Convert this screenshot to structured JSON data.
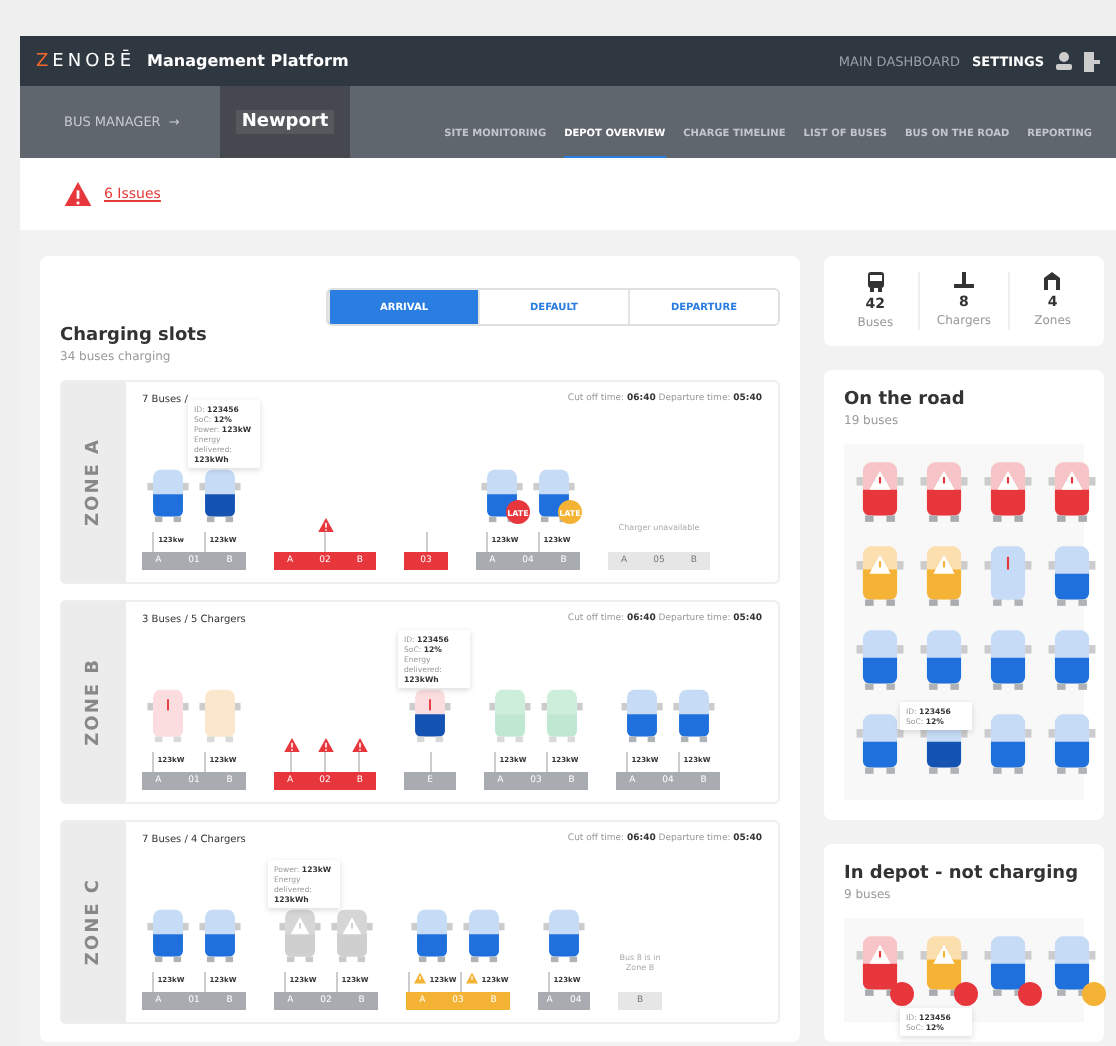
{
  "header": {
    "logo": "ZENOBĒ",
    "title": "Management Platform",
    "links": [
      {
        "label": "MAIN DASHBOARD",
        "selected": false
      },
      {
        "label": "SETTINGS",
        "selected": true
      }
    ]
  },
  "subnav": {
    "section": "BUS MANAGER",
    "arrow": "→",
    "depot": "Newport",
    "tabs": [
      {
        "label": "SITE MONITORING",
        "selected": false
      },
      {
        "label": "DEPOT OVERVIEW",
        "selected": true
      },
      {
        "label": "CHARGE TIMELINE",
        "selected": false
      },
      {
        "label": "LIST OF BUSES",
        "selected": false
      },
      {
        "label": "BUS ON THE ROAD",
        "selected": false
      },
      {
        "label": "REPORTING",
        "selected": false
      }
    ]
  },
  "issues": {
    "label": "6 Issues"
  },
  "charging": {
    "title": "Charging slots",
    "subtitle": "34 buses charging",
    "modes": [
      {
        "label": "ARRIVAL",
        "selected": true
      },
      {
        "label": "DEFAULT",
        "selected": false
      },
      {
        "label": "DEPARTURE",
        "selected": false
      }
    ],
    "zones": [
      {
        "label": "ZONE A",
        "summary": "7 Buses /",
        "cutoff_label": "Cut off time:",
        "cutoff": "06:40",
        "departure_label": "Departure time:",
        "departure": "05:40",
        "groups": [
          {
            "kind": "normal",
            "ports": [
              "A",
              "01",
              "B"
            ],
            "buses": [
              {
                "kind": "normal",
                "selected": false,
                "power": "123kw"
              },
              {
                "kind": "normal",
                "selected": true,
                "power": "123kW",
                "tooltip": [
                  {
                    "label": "ID:",
                    "value": "123456"
                  },
                  {
                    "label": "SoC:",
                    "value": "12%"
                  },
                  {
                    "label": "Power:",
                    "value": "123kW"
                  },
                  {
                    "label": "Energy delivered:",
                    "value": "123kWh"
                  }
                ]
              }
            ]
          },
          {
            "kind": "fault",
            "ports": [
              "A",
              "02",
              "B"
            ],
            "alerts": [
              {
                "kind": "warning"
              }
            ]
          },
          {
            "kind": "fault",
            "ports": [
              "03"
            ]
          },
          {
            "kind": "normal",
            "ports": [
              "A",
              "04",
              "B"
            ],
            "buses": [
              {
                "kind": "normal",
                "selected": false,
                "power": "123kW",
                "badge": {
                  "color": "#e8363d",
                  "text": "LATE"
                }
              },
              {
                "kind": "normal",
                "selected": false,
                "power": "123kW",
                "badge": {
                  "color": "#f5b335",
                  "text": "LATE"
                }
              }
            ]
          },
          {
            "kind": "unavailable",
            "ports": [
              "A",
              "05",
              "B"
            ],
            "note": "Charger unavailable"
          }
        ]
      },
      {
        "label": "ZONE B",
        "summary": "3 Buses / 5 Chargers",
        "cutoff_label": "Cut off time:",
        "cutoff": "06:40",
        "departure_label": "Departure time:",
        "departure": "05:40",
        "groups": [
          {
            "kind": "normal",
            "ports": [
              "A",
              "01",
              "B"
            ],
            "buses": [
              {
                "kind": "fault_faded",
                "selected": false,
                "power": "123kW"
              },
              {
                "kind": "warning_faded",
                "selected": false,
                "power": "123kW"
              }
            ]
          },
          {
            "kind": "fault",
            "ports": [
              "A",
              "02",
              "B"
            ],
            "alerts": [
              {
                "kind": "warning"
              },
              {
                "kind": "warning"
              },
              {
                "kind": "warning"
              }
            ]
          },
          {
            "kind": "normal",
            "ports": [
              "E"
            ],
            "buses": [
              {
                "kind": "fault_faded",
                "selected": true,
                "tooltip": [
                  {
                    "label": "ID:",
                    "value": "123456"
                  },
                  {
                    "label": "SoC:",
                    "value": "12%"
                  },
                  {
                    "label": "Energy delivered:",
                    "value": "123kWh"
                  }
                ]
              }
            ]
          },
          {
            "kind": "normal",
            "ports": [
              "A",
              "03",
              "B"
            ],
            "buses": [
              {
                "kind": "charged",
                "selected": false,
                "power": "123kW"
              },
              {
                "kind": "charged",
                "selected": false,
                "power": "123kW"
              }
            ]
          },
          {
            "kind": "normal",
            "ports": [
              "A",
              "04",
              "B"
            ],
            "buses": [
              {
                "kind": "normal",
                "selected": false,
                "power": "123kW"
              },
              {
                "kind": "normal",
                "selected": false,
                "power": "123kW"
              }
            ]
          }
        ]
      },
      {
        "label": "ZONE C",
        "summary": "7 Buses / 4 Chargers",
        "cutoff_label": "Cut off time:",
        "cutoff": "06:40",
        "departure_label": "Departure time:",
        "departure": "05:40",
        "groups": [
          {
            "kind": "normal",
            "ports": [
              "A",
              "01",
              "B"
            ],
            "buses": [
              {
                "kind": "normal",
                "selected": false,
                "power": "123kW"
              },
              {
                "kind": "normal",
                "selected": false,
                "power": "123kW"
              }
            ]
          },
          {
            "kind": "normal",
            "ports": [
              "A",
              "02",
              "B"
            ],
            "buses": [
              {
                "kind": "offline",
                "selected": false,
                "power": "123kW",
                "tooltip": [
                  {
                    "label": "Power:",
                    "value": "123kW"
                  },
                  {
                    "label": "Energy delivered:",
                    "value": "123kWh"
                  }
                ]
              },
              {
                "kind": "offline",
                "selected": false,
                "power": "123kW"
              }
            ]
          },
          {
            "kind": "warning",
            "ports": [
              "A",
              "03",
              "B"
            ],
            "buses": [
              {
                "kind": "normal",
                "selected": false,
                "power": "123kW",
                "power_alert": true
              },
              {
                "kind": "normal",
                "selected": false,
                "power": "123kW",
                "power_alert": true
              }
            ]
          },
          {
            "kind": "normal",
            "ports": [
              "A",
              "04"
            ],
            "buses": [
              {
                "kind": "normal",
                "selected": false,
                "power": "123kW"
              }
            ]
          },
          {
            "kind": "unavailable",
            "ports": [
              "B"
            ],
            "note": "Bus 8 is in Zone B"
          }
        ]
      }
    ]
  },
  "stats": [
    {
      "kind": "bus",
      "value": "42",
      "label": "Buses"
    },
    {
      "kind": "charger",
      "value": "8",
      "label": "Chargers"
    },
    {
      "kind": "zone",
      "value": "4",
      "label": "Zones"
    }
  ],
  "on_the_road": {
    "title": "On the road",
    "subtitle": "19 buses",
    "buses": [
      {
        "kind": "fault",
        "selected": false
      },
      {
        "kind": "fault",
        "selected": false
      },
      {
        "kind": "fault",
        "selected": false
      },
      {
        "kind": "fault",
        "selected": false
      },
      {
        "kind": "warning",
        "selected": false
      },
      {
        "kind": "warning",
        "selected": false
      },
      {
        "kind": "alert",
        "selected": false
      },
      {
        "kind": "normal",
        "selected": false
      },
      {
        "kind": "normal",
        "selected": false
      },
      {
        "kind": "normal",
        "selected": false,
        "tooltip": [
          {
            "label": "ID:",
            "value": "123456"
          },
          {
            "label": "SoC:",
            "value": "12%"
          }
        ]
      },
      {
        "kind": "normal",
        "selected": false
      },
      {
        "kind": "normal",
        "selected": false
      },
      {
        "kind": "normal",
        "selected": false
      },
      {
        "kind": "normal",
        "selected": true
      },
      {
        "kind": "normal",
        "selected": false
      },
      {
        "kind": "normal",
        "selected": false
      }
    ]
  },
  "in_depot": {
    "title": "In depot - not charging",
    "subtitle": "9 buses",
    "buses": [
      {
        "kind": "fault",
        "selected": false,
        "badge": {
          "color": "#e8363d"
        }
      },
      {
        "kind": "warning",
        "selected": false,
        "badge": {
          "color": "#e8363d"
        },
        "tooltip": [
          {
            "label": "ID:",
            "value": "123456"
          },
          {
            "label": "SoC:",
            "value": "12%"
          }
        ]
      },
      {
        "kind": "normal",
        "selected": false,
        "badge": {
          "color": "#e8363d"
        }
      },
      {
        "kind": "normal",
        "selected": false,
        "badge": {
          "color": "#f5b335"
        }
      }
    ]
  }
}
